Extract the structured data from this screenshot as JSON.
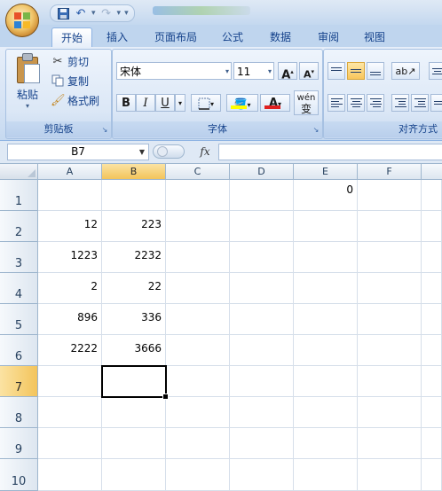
{
  "quick_access": {
    "undo_arrow": "▾",
    "redo_arrow": "▾",
    "customize_arrow": "▾"
  },
  "tabs": [
    "开始",
    "插入",
    "页面布局",
    "公式",
    "数据",
    "审阅",
    "视图"
  ],
  "ribbon": {
    "clipboard": {
      "paste_label": "粘贴",
      "cut_label": "剪切",
      "copy_label": "复制",
      "format_painter_label": "格式刷",
      "group_label": "剪贴板"
    },
    "font": {
      "font_name": "宋体",
      "font_size": "11",
      "grow_label": "A",
      "shrink_label": "A",
      "bold_label": "B",
      "italic_label": "I",
      "underline_label": "U",
      "phonetic_label": "wén",
      "phonetic_sub": "变",
      "font_color_label": "A",
      "group_label": "字体"
    },
    "alignment": {
      "group_label": "对齐方式"
    }
  },
  "formula_bar": {
    "name_box": "B7",
    "fx_label": "fx",
    "formula": ""
  },
  "sheet": {
    "columns": [
      "A",
      "B",
      "C",
      "D",
      "E",
      "F"
    ],
    "rows": [
      "1",
      "2",
      "3",
      "4",
      "5",
      "6",
      "7",
      "8",
      "9",
      "10"
    ],
    "selected_column": "B",
    "selected_row": "7",
    "cells": {
      "E1": "0",
      "A2": "12",
      "B2": "223",
      "A3": "1223",
      "B3": "2232",
      "A4": "2",
      "B4": "22",
      "A5": "896",
      "B5": "336",
      "A6": "2222",
      "B6": "3666"
    }
  },
  "colors": {
    "ribbon_bg": "#d4e2f4",
    "selected_header": "#f3c45b",
    "grid_line": "#d6dfea",
    "header_text": "#27415f",
    "font_color_bar": "#e02020",
    "highlight_bar": "#ffff00"
  }
}
